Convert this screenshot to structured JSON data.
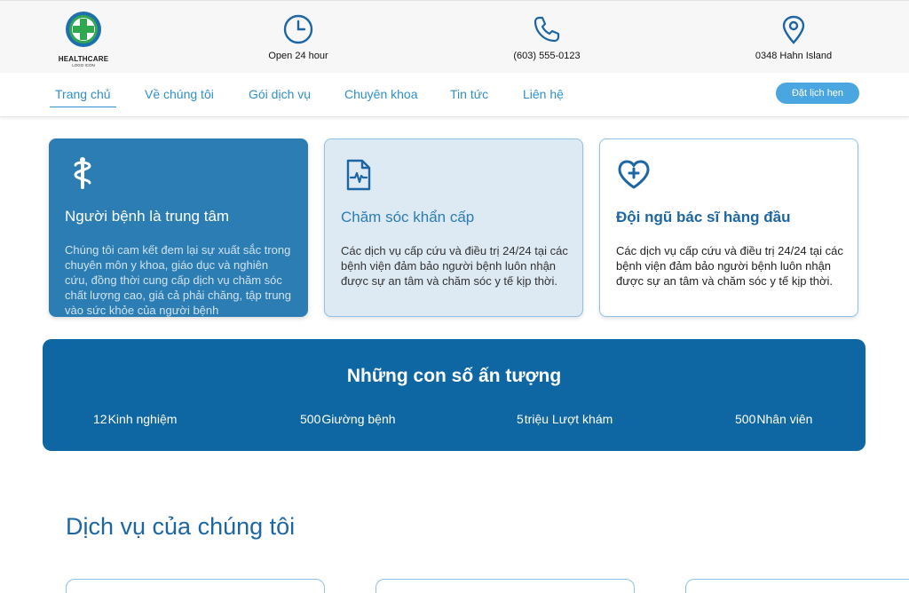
{
  "header": {
    "logo": {
      "line1": "HEALTHCARE",
      "line2": "LOGO ICON"
    },
    "info": [
      {
        "icon": "clock-icon",
        "text": "Open 24 hour"
      },
      {
        "icon": "phone-icon",
        "text": "(603) 555-0123"
      },
      {
        "icon": "location-pin-icon",
        "text": "0348 Hahn Island"
      }
    ]
  },
  "nav": {
    "items": [
      "Trang chủ",
      "Về chúng tôi",
      "Gói dịch vụ",
      "Chuyên khoa",
      "Tin tức",
      "Liên hệ"
    ],
    "active_index": 0,
    "cta": "Đặt lịch hẹn"
  },
  "features": [
    {
      "icon": "caduceus-icon",
      "title": "Người bệnh là trung tâm",
      "text": "Chúng tôi cam kết đem lại sự xuất sắc trong chuyên môn y khoa, giáo dục và nghiên cứu, đồng thời cung cấp dịch vụ chăm sóc chất lượng cao, giá cả phải chăng, tập trung vào sức khỏe của người bệnh"
    },
    {
      "icon": "medical-report-icon",
      "title": "Chăm sóc khẩn cấp",
      "text": "Các dịch vụ cấp cứu và điều trị 24/24 tại các bệnh viện đảm bảo người bệnh luôn nhận được sự an tâm và chăm sóc y tế kịp thời."
    },
    {
      "icon": "heart-plus-icon",
      "title": "Đội ngũ bác sĩ hàng đầu",
      "text": "Các dịch vụ cấp cứu và điều trị 24/24 tại các bệnh viện đảm bảo người bệnh luôn nhận được sự an tâm và chăm sóc y tế kịp thời."
    }
  ],
  "stats": {
    "title": "Những con số ấn tượng",
    "items": [
      {
        "number": "12",
        "label": "Kinh nghiệm"
      },
      {
        "number": "500",
        "label": "Giường bệnh"
      },
      {
        "number": "5",
        "label": "triệu Lượt khám"
      },
      {
        "number": "500",
        "label": "Nhân viên"
      }
    ]
  },
  "services": {
    "title": "Dịch vụ của chúng tôi"
  },
  "colors": {
    "primary": "#2b7db3",
    "dark_primary": "#0e67a3",
    "accent": "#4aa6e0",
    "logo_green": "#2fa84f"
  }
}
